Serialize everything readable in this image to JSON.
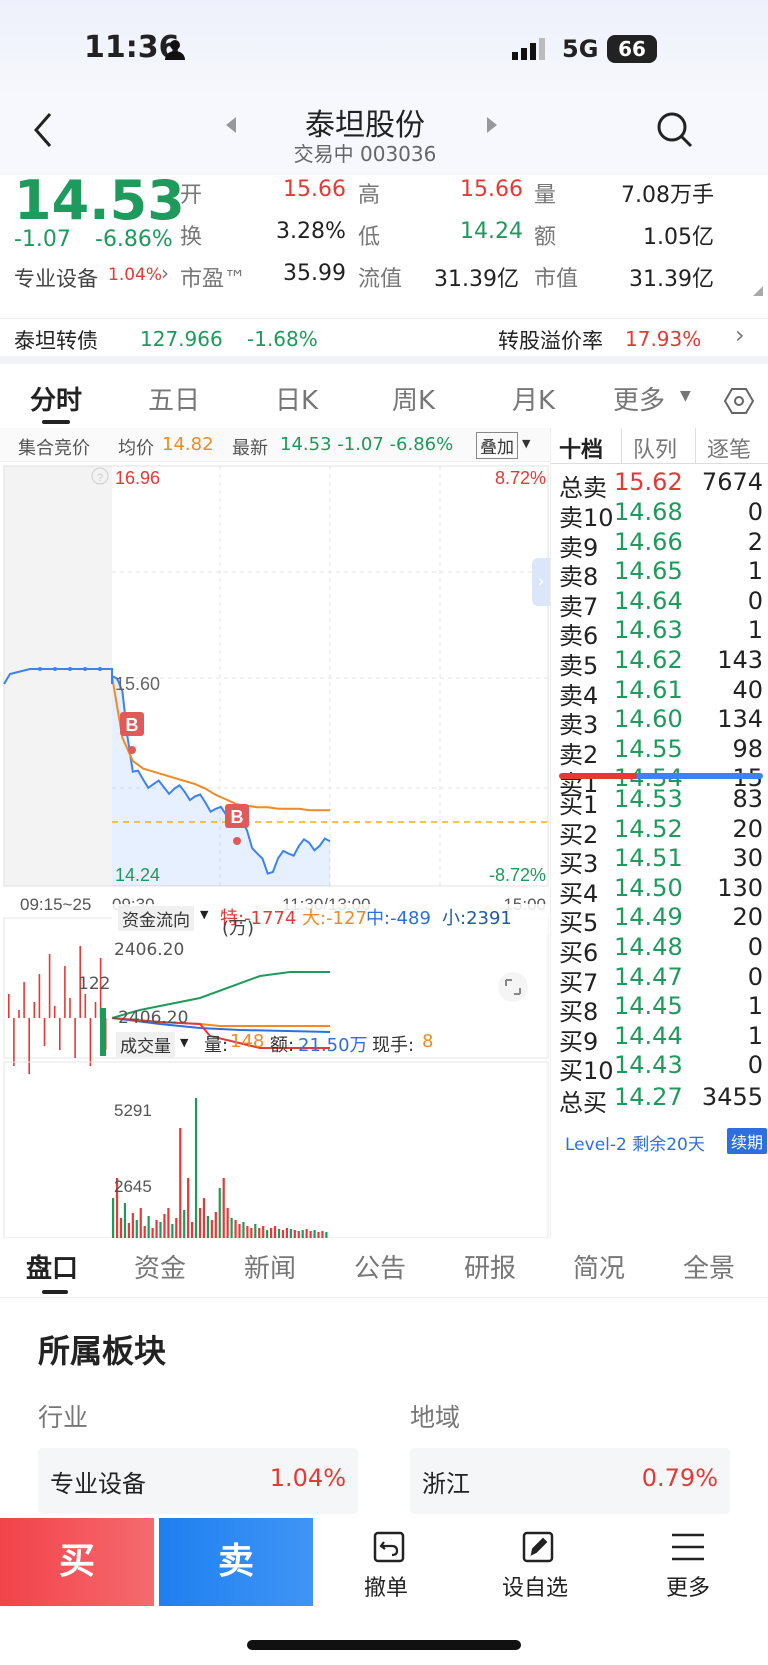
{
  "status": {
    "time": "11:36",
    "network": "5G",
    "battery": "66"
  },
  "header": {
    "title": "泰坦股份",
    "subtitle": "交易中 003036"
  },
  "quote": {
    "price": "14.53",
    "change": "-1.07",
    "change_pct": "-6.86%",
    "sector_name": "专业设备",
    "sector_pct": "1.04%",
    "open_label": "开",
    "open": "15.66",
    "high_label": "高",
    "high": "15.66",
    "vol_label": "量",
    "vol": "7.08万手",
    "turn_label": "换",
    "turn": "3.28%",
    "low_label": "低",
    "low": "14.24",
    "amt_label": "额",
    "amt": "1.05亿",
    "pe_label": "市盈™",
    "pe": "35.99",
    "float_label": "流值",
    "float": "31.39亿",
    "mcap_label": "市值",
    "mcap": "31.39亿"
  },
  "bond": {
    "name": "泰坦转债",
    "price": "127.966",
    "pct": "-1.68%",
    "premium_label": "转股溢价率",
    "premium": "17.93%"
  },
  "tabs": [
    "分时",
    "五日",
    "日K",
    "周K",
    "月K",
    "更多"
  ],
  "chart_info": {
    "auction": "集合竞价",
    "avg_label": "均价",
    "avg": "14.82",
    "latest_label": "最新",
    "latest": "14.53 -1.07 -6.86%",
    "overlay": "叠加"
  },
  "chart_data": {
    "type": "line",
    "y_top": "16.96",
    "y_top_pct": "8.72%",
    "y_mid": "15.60",
    "y_bot": "14.24",
    "y_bot_pct": "-8.72%",
    "x_labels": [
      "09:15~25",
      "09:30",
      "11:30/13:00",
      "15:00"
    ],
    "markers": [
      "B",
      "B"
    ],
    "prev_close": 15.6,
    "series": [
      {
        "color": "#3b82f6",
        "values": [
          15.6,
          15.5,
          14.98,
          14.93,
          14.9,
          14.88,
          14.87,
          14.85,
          14.82,
          14.78,
          14.74,
          14.7,
          14.66,
          14.6,
          14.45,
          14.32,
          14.42,
          14.45,
          14.5,
          14.52,
          14.5,
          14.53
        ]
      },
      {
        "color": "#f08a24",
        "values": [
          15.6,
          15.2,
          15.05,
          15.0,
          14.98,
          14.96,
          14.94,
          14.92,
          14.9,
          14.87,
          14.83,
          14.8,
          14.77,
          14.76,
          14.75,
          14.75,
          14.74,
          14.74,
          14.74,
          14.73,
          14.73,
          14.73
        ]
      }
    ]
  },
  "flow": {
    "title": "资金流向",
    "special": "特:-1774",
    "big": "大:-127",
    "mid": "中:-489",
    "small": "小:2391",
    "unit": "(万)",
    "top": "2406.20",
    "left": "122",
    "bot": "-2406.20"
  },
  "vol_panel": {
    "title": "成交量",
    "vol_label": "量:",
    "vol": "148",
    "amt_label": "额:",
    "amt": "21.50万",
    "hand_label": "现手:",
    "hand": "8",
    "y1": "5291",
    "y2": "2645"
  },
  "book": {
    "tabs": [
      "十档",
      "队列",
      "逐笔"
    ],
    "total_sell": {
      "label": "总卖",
      "price": "15.62",
      "vol": "7674"
    },
    "asks": [
      {
        "l": "卖10",
        "p": "14.68",
        "v": "0"
      },
      {
        "l": "卖9",
        "p": "14.66",
        "v": "2"
      },
      {
        "l": "卖8",
        "p": "14.65",
        "v": "1"
      },
      {
        "l": "卖7",
        "p": "14.64",
        "v": "0"
      },
      {
        "l": "卖6",
        "p": "14.63",
        "v": "1"
      },
      {
        "l": "卖5",
        "p": "14.62",
        "v": "143"
      },
      {
        "l": "卖4",
        "p": "14.61",
        "v": "40"
      },
      {
        "l": "卖3",
        "p": "14.60",
        "v": "134"
      },
      {
        "l": "卖2",
        "p": "14.55",
        "v": "98"
      },
      {
        "l": "卖1",
        "p": "14.54",
        "v": "15"
      }
    ],
    "bids": [
      {
        "l": "买1",
        "p": "14.53",
        "v": "83"
      },
      {
        "l": "买2",
        "p": "14.52",
        "v": "20"
      },
      {
        "l": "买3",
        "p": "14.51",
        "v": "30"
      },
      {
        "l": "买4",
        "p": "14.50",
        "v": "130"
      },
      {
        "l": "买5",
        "p": "14.49",
        "v": "20"
      },
      {
        "l": "买6",
        "p": "14.48",
        "v": "0"
      },
      {
        "l": "买7",
        "p": "14.47",
        "v": "0"
      },
      {
        "l": "买8",
        "p": "14.45",
        "v": "1"
      },
      {
        "l": "买9",
        "p": "14.44",
        "v": "1"
      },
      {
        "l": "买10",
        "p": "14.43",
        "v": "0"
      }
    ],
    "total_buy": {
      "label": "总买",
      "price": "14.27",
      "vol": "3455"
    },
    "level2": "Level-2 剩余20天",
    "renew": "续期"
  },
  "bottom_tabs": [
    "盘口",
    "资金",
    "新闻",
    "公告",
    "研报",
    "简况",
    "全景"
  ],
  "sector": {
    "title": "所属板块",
    "industry_label": "行业",
    "region_label": "地域",
    "industry": "专业设备",
    "industry_pct": "1.04%",
    "region": "浙江",
    "region_pct": "0.79%"
  },
  "actions": {
    "buy": "买",
    "sell": "卖",
    "cancel": "撤单",
    "watch": "设自选",
    "more": "更多"
  }
}
